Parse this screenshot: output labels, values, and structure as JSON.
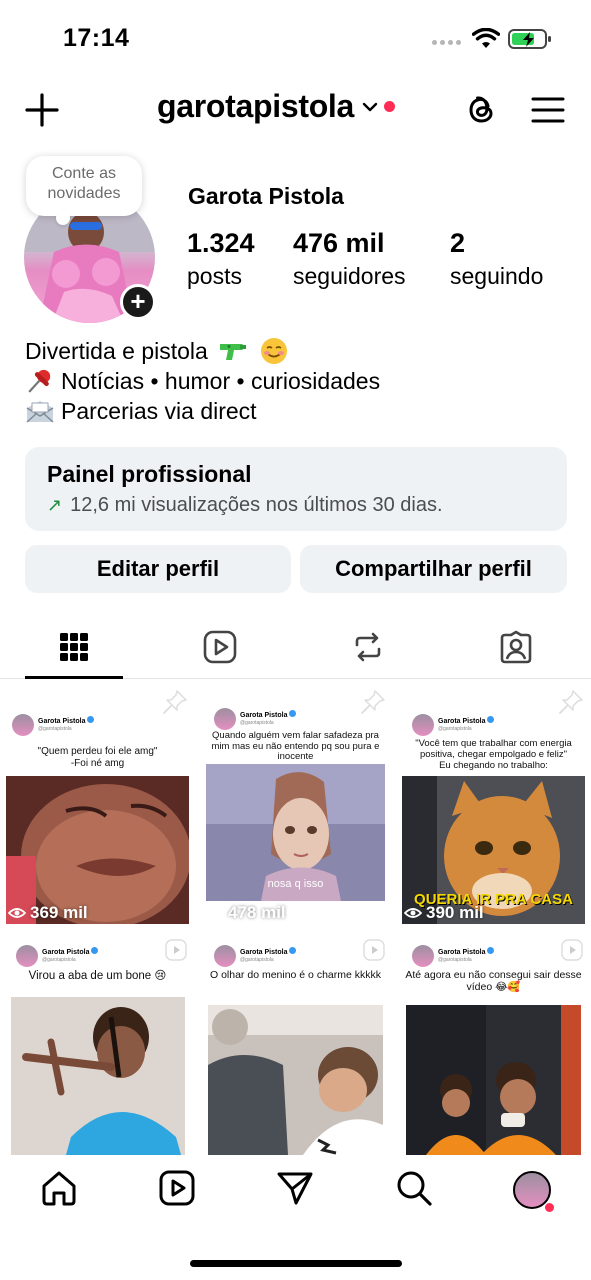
{
  "status_bar": {
    "time": "17:14"
  },
  "header": {
    "username": "garotapistola"
  },
  "profile": {
    "note": "Conte as novidades",
    "name": "Garota Pistola",
    "stats": [
      {
        "value": "1.324",
        "label": "posts"
      },
      {
        "value": "476 mil",
        "label": "seguidores"
      },
      {
        "value": "2",
        "label": "seguindo"
      }
    ],
    "bio": [
      {
        "text": "Divertida e pistola",
        "icons": [
          "water-pistol-icon",
          "smiling-face-icon"
        ]
      },
      {
        "icon": "pushpin-icon",
        "text": "Notícias • humor • curiosidades"
      },
      {
        "icon": "envelope-icon",
        "text": "Parcerias via direct"
      }
    ]
  },
  "dashboard": {
    "title": "Painel profissional",
    "subtitle": "12,6 mi visualizações nos últimos 30 dias."
  },
  "actions": {
    "edit": "Editar perfil",
    "share": "Compartilhar perfil"
  },
  "tabs": [
    "grid-icon",
    "reels-icon",
    "reposts-icon",
    "tagged-icon"
  ],
  "posts": [
    {
      "author": "Garota Pistola",
      "caption": "\"Quem perdeu foi ele amg\"\n-Foi né amg",
      "views": "369 mil",
      "pinned": true
    },
    {
      "author": "Garota Pistola",
      "caption": "Quando alguém vem falar safadeza pra mim mas eu não entendo pq sou pura e inocente",
      "overlay": "nosa q isso",
      "views": "478 mil",
      "pinned": true
    },
    {
      "author": "Garota Pistola",
      "caption": "\"Você tem que trabalhar com energia positiva, chegar empolgado e feliz\"\nEu chegando no trabalho:",
      "overlay": "QUERIA IR PRA CASA",
      "views": "390 mil",
      "pinned": true
    },
    {
      "author": "Garota Pistola",
      "caption": "Virou a aba de um bone 😢"
    },
    {
      "author": "Garota Pistola",
      "caption": "O olhar do menino é o charme kkkkk"
    },
    {
      "author": "Garota Pistola",
      "caption": "Até agora eu não consegui sair desse vídeo 😂🥰"
    }
  ],
  "bottom_nav": [
    "home-icon",
    "reels-icon",
    "direct-icon",
    "search-icon",
    "profile-avatar"
  ]
}
